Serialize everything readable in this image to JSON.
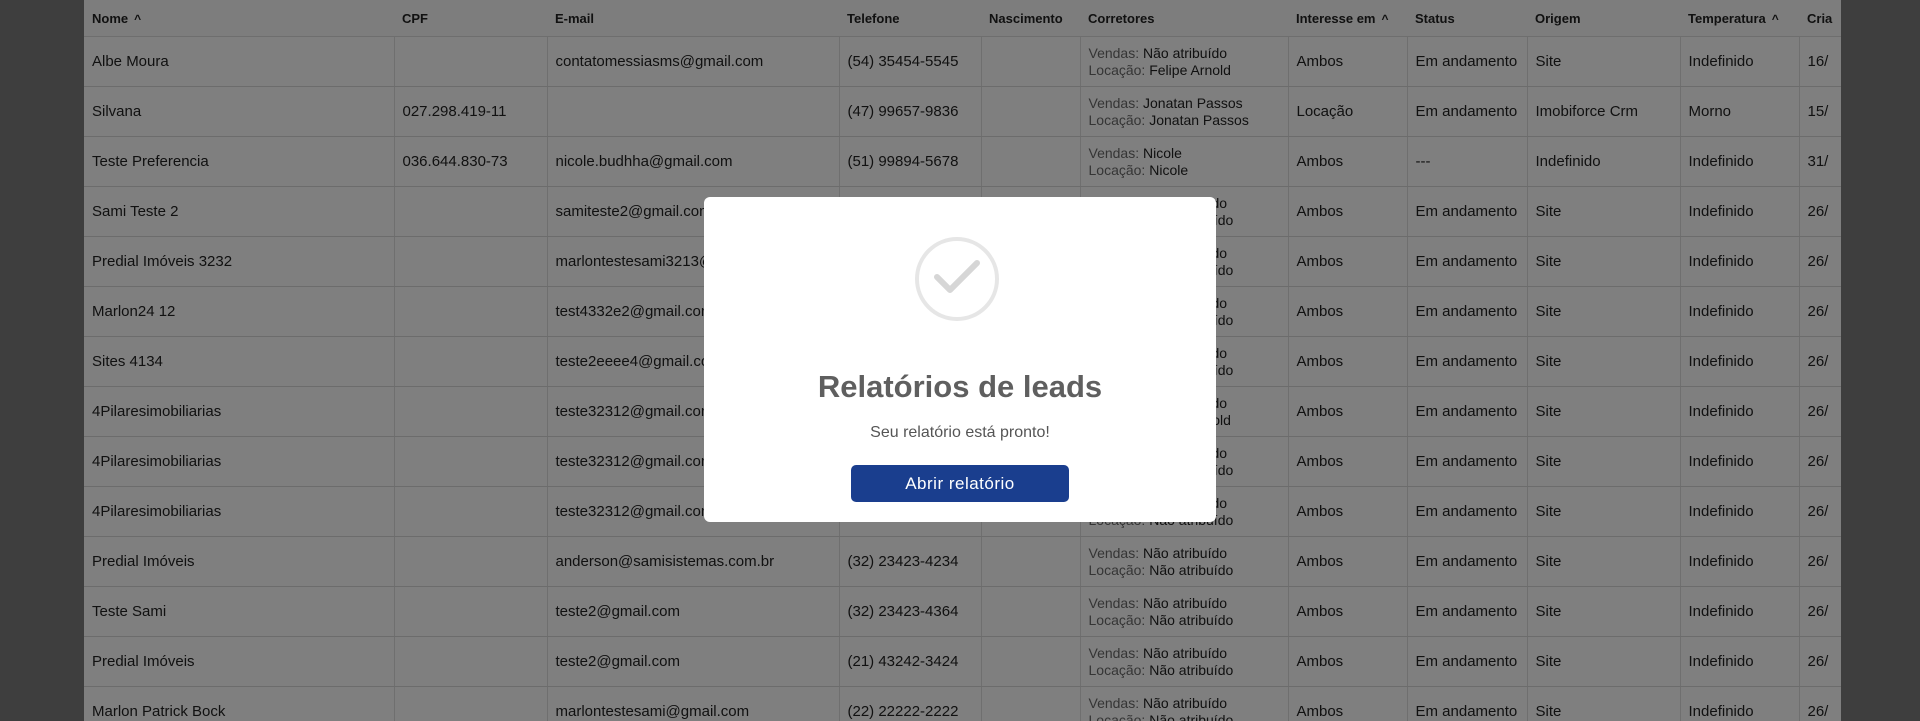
{
  "table": {
    "headers": [
      {
        "label": "Nome",
        "sort": "^"
      },
      {
        "label": "CPF"
      },
      {
        "label": "E-mail"
      },
      {
        "label": "Telefone"
      },
      {
        "label": "Nascimento"
      },
      {
        "label": "Corretores"
      },
      {
        "label": "Interesse em",
        "sort": "^"
      },
      {
        "label": "Status"
      },
      {
        "label": "Origem"
      },
      {
        "label": "Temperatura",
        "sort": "^"
      },
      {
        "label": "Cria"
      }
    ],
    "corretor_labels": {
      "vendas": "Vendas:",
      "locacao": "Locação:"
    },
    "rows": [
      {
        "nome": "Albe Moura",
        "cpf": "",
        "email": "contatomessiasms@gmail.com",
        "telefone": "(54) 35454-5545",
        "nascimento": "",
        "vendas": "Não atribuído",
        "locacao": "Felipe Arnold",
        "interesse": "Ambos",
        "status": "Em andamento",
        "origem": "Site",
        "temperatura": "Indefinido",
        "criacao": "16/"
      },
      {
        "nome": "Silvana",
        "cpf": "027.298.419-11",
        "email": "",
        "telefone": "(47) 99657-9836",
        "nascimento": "",
        "vendas": "Jonatan Passos",
        "locacao": "Jonatan Passos",
        "interesse": "Locação",
        "status": "Em andamento",
        "origem": "Imobiforce Crm",
        "temperatura": "Morno",
        "criacao": "15/"
      },
      {
        "nome": "Teste Preferencia",
        "cpf": "036.644.830-73",
        "email": "nicole.budhha@gmail.com",
        "telefone": "(51) 99894-5678",
        "nascimento": "",
        "vendas": "Nicole",
        "locacao": "Nicole",
        "interesse": "Ambos",
        "status": "---",
        "origem": "Indefinido",
        "temperatura": "Indefinido",
        "criacao": "31/"
      },
      {
        "nome": "Sami Teste 2",
        "cpf": "",
        "email": "samiteste2@gmail.com",
        "telefone": "",
        "nascimento": "",
        "vendas": "Não atribuído",
        "locacao": "Não atribuído",
        "interesse": "Ambos",
        "status": "Em andamento",
        "origem": "Site",
        "temperatura": "Indefinido",
        "criacao": "26/"
      },
      {
        "nome": "Predial Imóveis 3232",
        "cpf": "",
        "email": "marlontestesami3213@gmail.com",
        "telefone": "",
        "nascimento": "",
        "vendas": "Não atribuído",
        "locacao": "Não atribuído",
        "interesse": "Ambos",
        "status": "Em andamento",
        "origem": "Site",
        "temperatura": "Indefinido",
        "criacao": "26/"
      },
      {
        "nome": "Marlon24 12",
        "cpf": "",
        "email": "test4332e2@gmail.com",
        "telefone": "",
        "nascimento": "",
        "vendas": "Não atribuído",
        "locacao": "Não atribuído",
        "interesse": "Ambos",
        "status": "Em andamento",
        "origem": "Site",
        "temperatura": "Indefinido",
        "criacao": "26/"
      },
      {
        "nome": "Sites 4134",
        "cpf": "",
        "email": "teste2eeee4@gmail.com",
        "telefone": "",
        "nascimento": "",
        "vendas": "Não atribuído",
        "locacao": "Não atribuído",
        "interesse": "Ambos",
        "status": "Em andamento",
        "origem": "Site",
        "temperatura": "Indefinido",
        "criacao": "26/"
      },
      {
        "nome": "4Pilaresimobiliarias",
        "cpf": "",
        "email": "teste32312@gmail.com",
        "telefone": "",
        "nascimento": "",
        "vendas": "Não atribuído",
        "locacao": "Felipe Arnold",
        "interesse": "Ambos",
        "status": "Em andamento",
        "origem": "Site",
        "temperatura": "Indefinido",
        "criacao": "26/"
      },
      {
        "nome": "4Pilaresimobiliarias",
        "cpf": "",
        "email": "teste32312@gmail.com",
        "telefone": "",
        "nascimento": "",
        "vendas": "Não atribuído",
        "locacao": "Não atribuído",
        "interesse": "Ambos",
        "status": "Em andamento",
        "origem": "Site",
        "temperatura": "Indefinido",
        "criacao": "26/"
      },
      {
        "nome": "4Pilaresimobiliarias",
        "cpf": "",
        "email": "teste32312@gmail.com",
        "telefone": "",
        "nascimento": "",
        "vendas": "Não atribuído",
        "locacao": "Não atribuído",
        "interesse": "Ambos",
        "status": "Em andamento",
        "origem": "Site",
        "temperatura": "Indefinido",
        "criacao": "26/"
      },
      {
        "nome": "Predial Imóveis",
        "cpf": "",
        "email": "anderson@samisistemas.com.br",
        "telefone": "(32) 23423-4234",
        "nascimento": "",
        "vendas": "Não atribuído",
        "locacao": "Não atribuído",
        "interesse": "Ambos",
        "status": "Em andamento",
        "origem": "Site",
        "temperatura": "Indefinido",
        "criacao": "26/"
      },
      {
        "nome": "Teste Sami",
        "cpf": "",
        "email": "teste2@gmail.com",
        "telefone": "(32) 23423-4364",
        "nascimento": "",
        "vendas": "Não atribuído",
        "locacao": "Não atribuído",
        "interesse": "Ambos",
        "status": "Em andamento",
        "origem": "Site",
        "temperatura": "Indefinido",
        "criacao": "26/"
      },
      {
        "nome": "Predial Imóveis",
        "cpf": "",
        "email": "teste2@gmail.com",
        "telefone": "(21) 43242-3424",
        "nascimento": "",
        "vendas": "Não atribuído",
        "locacao": "Não atribuído",
        "interesse": "Ambos",
        "status": "Em andamento",
        "origem": "Site",
        "temperatura": "Indefinido",
        "criacao": "26/"
      },
      {
        "nome": "Marlon Patrick Bock",
        "cpf": "",
        "email": "marlontestesami@gmail.com",
        "telefone": "(22) 22222-2222",
        "nascimento": "",
        "vendas": "Não atribuído",
        "locacao": "Não atribuído",
        "interesse": "Ambos",
        "status": "Em andamento",
        "origem": "Site",
        "temperatura": "Indefinido",
        "criacao": "26/"
      }
    ]
  },
  "modal": {
    "icon": "check-icon",
    "title": "Relatórios de leads",
    "message": "Seu relatório está pronto!",
    "button_label": "Abrir relatório",
    "button_color": "#1a3e8e"
  }
}
